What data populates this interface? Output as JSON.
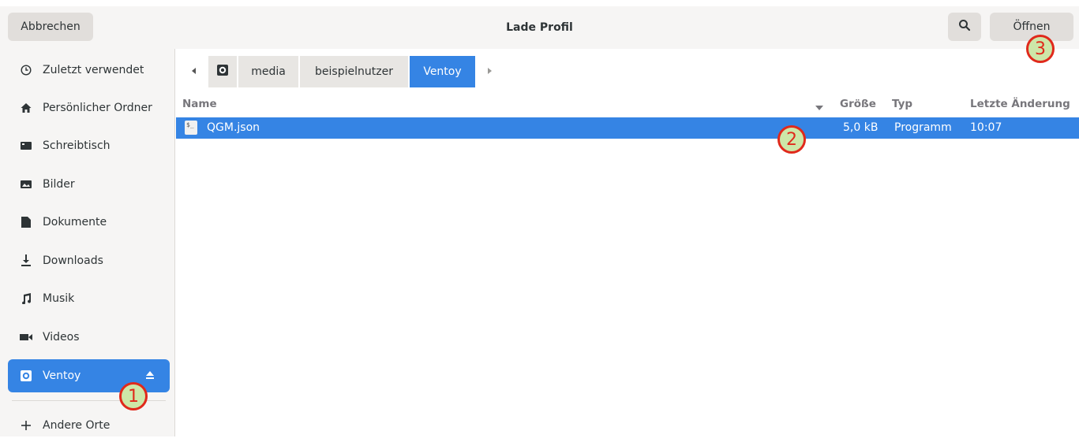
{
  "header": {
    "title": "Lade Profil",
    "cancel_label": "Abbrechen",
    "open_label": "Öffnen",
    "search_icon": "search-icon"
  },
  "sidebar": {
    "items": [
      {
        "label": "Zuletzt verwendet",
        "icon": "clock-icon"
      },
      {
        "label": "Persönlicher Ordner",
        "icon": "home-icon"
      },
      {
        "label": "Schreibtisch",
        "icon": "desktop-icon"
      },
      {
        "label": "Bilder",
        "icon": "image-icon"
      },
      {
        "label": "Dokumente",
        "icon": "document-icon"
      },
      {
        "label": "Downloads",
        "icon": "download-icon"
      },
      {
        "label": "Musik",
        "icon": "music-icon"
      },
      {
        "label": "Videos",
        "icon": "video-icon"
      },
      {
        "label": "Ventoy",
        "icon": "drive-icon",
        "active": true
      },
      {
        "label": "Andere Orte",
        "icon": "plus-icon"
      }
    ]
  },
  "pathbar": {
    "segments": [
      "media",
      "beispielnutzer",
      "Ventoy"
    ],
    "active": "Ventoy"
  },
  "list": {
    "columns": {
      "name": "Name",
      "size": "Größe",
      "type": "Typ",
      "modified": "Letzte Änderung"
    },
    "rows": [
      {
        "name": "QGM.json",
        "size": "5,0 kB",
        "type": "Programm",
        "modified": "10:07",
        "selected": true
      }
    ]
  },
  "markers": [
    "1",
    "2",
    "3"
  ],
  "colors": {
    "accent": "#3584e4",
    "marker_border": "#e0291b",
    "marker_fill": "#cde7a8"
  }
}
